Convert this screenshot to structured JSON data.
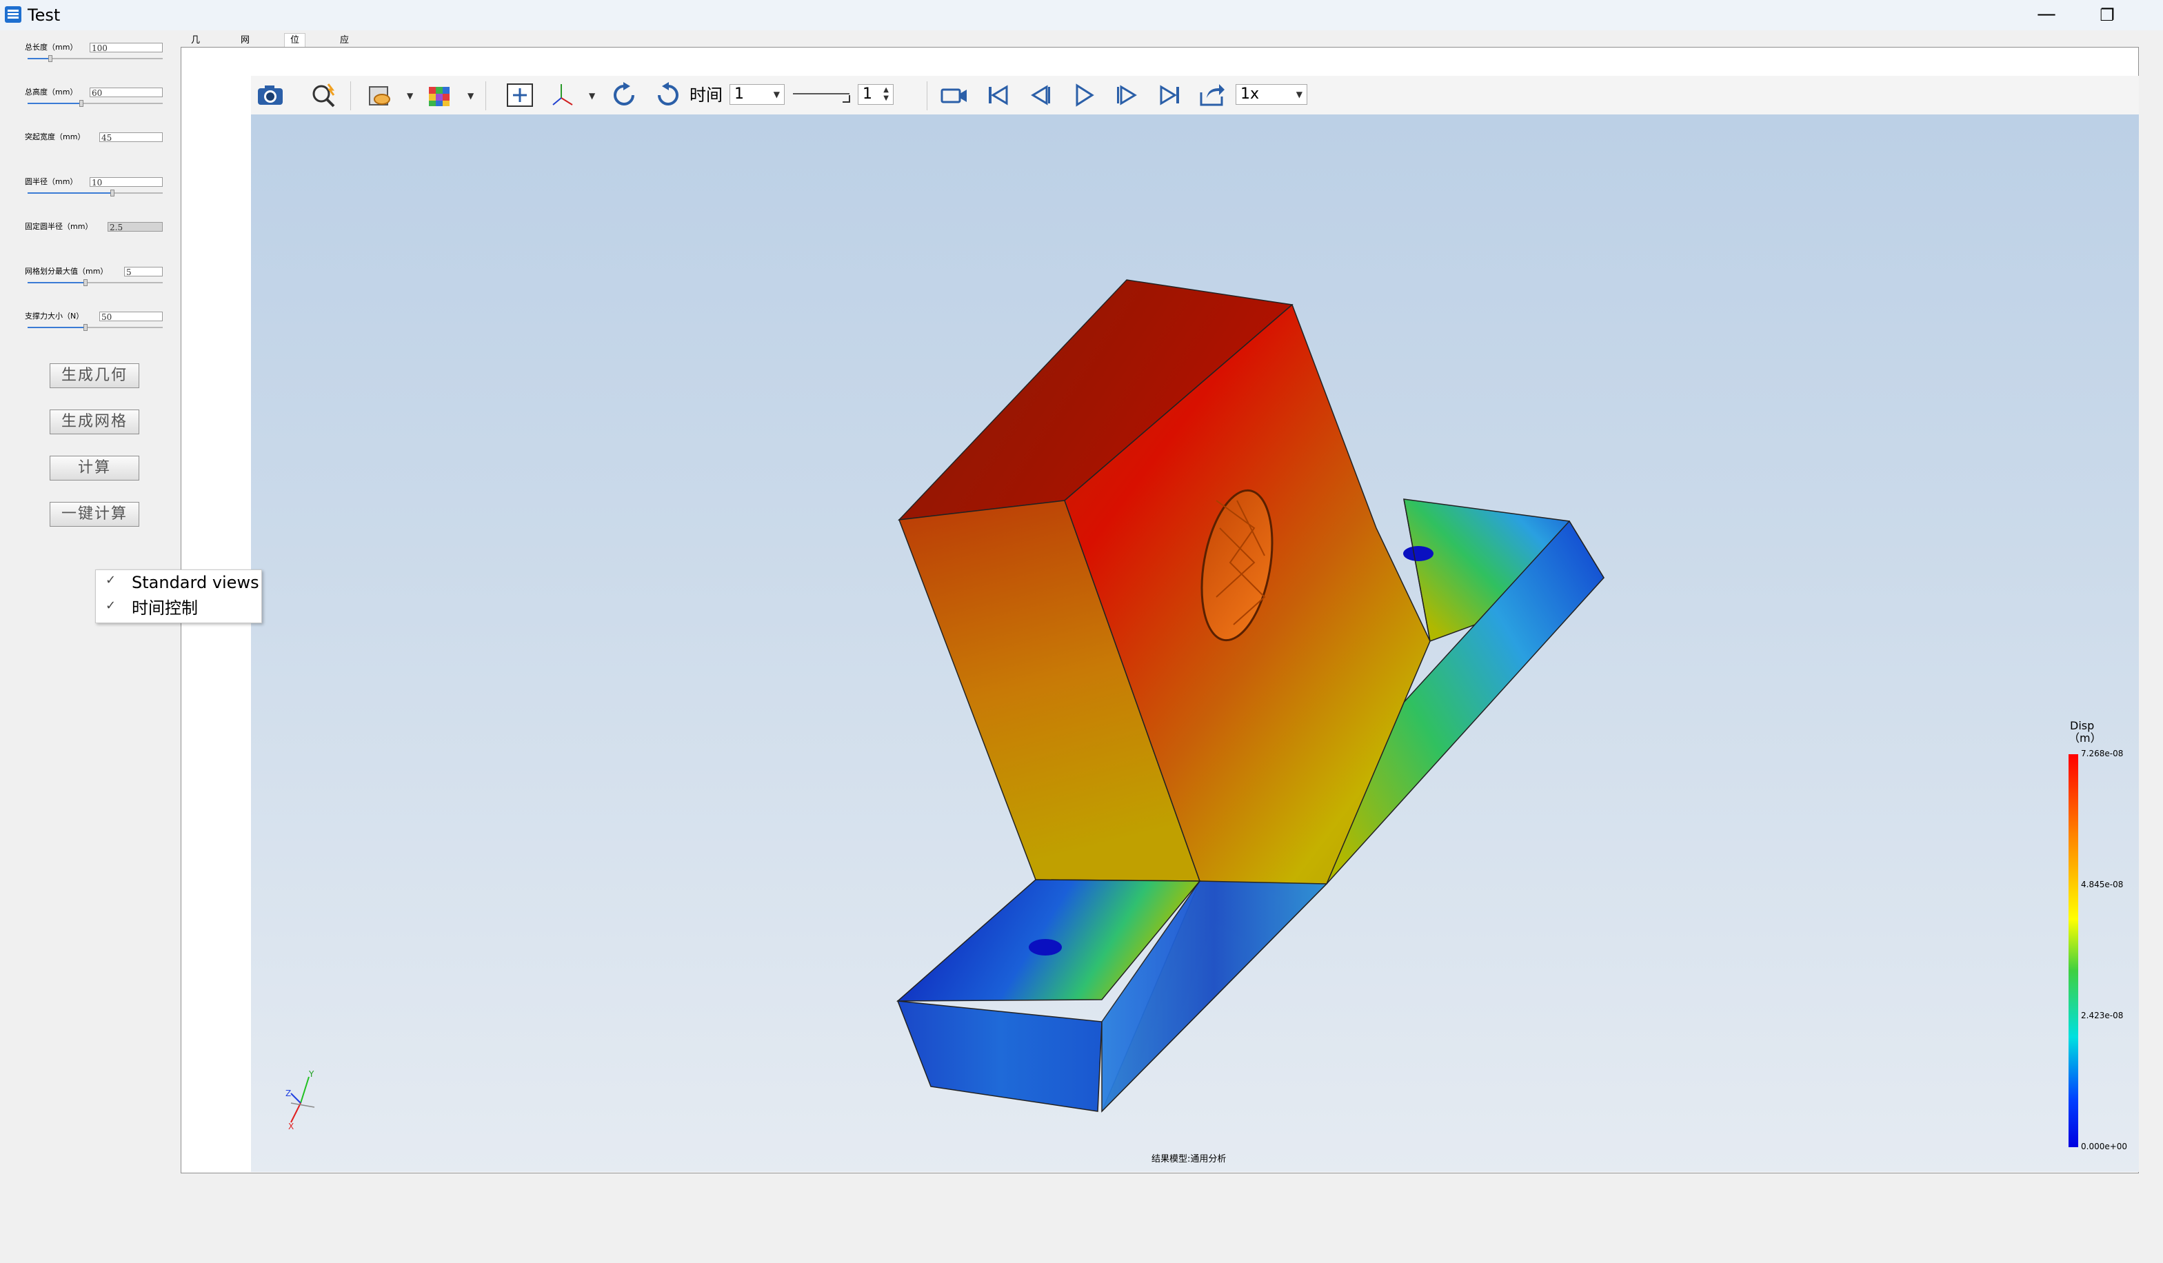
{
  "window": {
    "title": "Test"
  },
  "params": [
    {
      "label": "总长度（mm）",
      "value": "100",
      "fill": 0.17
    },
    {
      "label": "总高度（mm）",
      "value": "60",
      "fill": 0.4
    },
    {
      "label": "突起宽度（mm）",
      "value": "45",
      "fill": null
    },
    {
      "label": "圆半径（mm）",
      "value": "10",
      "fill": 0.63
    },
    {
      "label": "固定圆半径（mm）",
      "value": "2.5",
      "fill": null
    },
    {
      "label": "网格划分最大值（mm）",
      "value": "5",
      "fill": 0.43
    },
    {
      "label": "支撑力大小（N）",
      "value": "50",
      "fill": 0.43
    }
  ],
  "buttons": {
    "generate_geometry": "生成几何",
    "generate_mesh": "生成网格",
    "compute": "计算",
    "one_click": "一键计算"
  },
  "context_menu": {
    "items": [
      {
        "label": "Standard views",
        "checked": true
      },
      {
        "label": "时间控制",
        "checked": true
      }
    ]
  },
  "tabs": [
    {
      "label": "几何图形",
      "active": false
    },
    {
      "label": "网格划分",
      "active": false
    },
    {
      "label": "位移云图",
      "active": true
    },
    {
      "label": "应力云图",
      "active": false
    }
  ],
  "toolbar": {
    "time_label": "时间",
    "time_value": "1",
    "step_value": "1",
    "speed": "1x"
  },
  "legend": {
    "title": "Disp",
    "unit": "（m）",
    "max": "7.268e-08",
    "v2": "4.845e-08",
    "v3": "2.423e-08",
    "min": "0.000e+00"
  },
  "status": "结果模型:通用分析",
  "colors": {
    "accent": "#3a7bd5",
    "titlebar": "#eef3f9"
  }
}
